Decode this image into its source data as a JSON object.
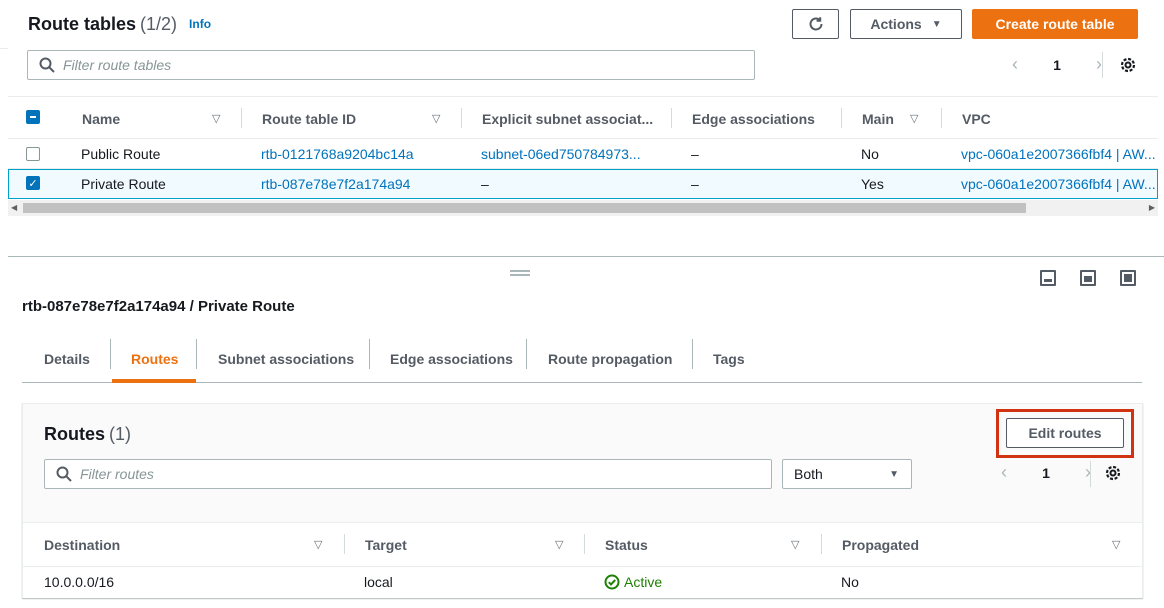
{
  "header": {
    "title": "Route tables",
    "count": "(1/2)",
    "info": "Info",
    "actions_label": "Actions",
    "create_label": "Create route table",
    "search_placeholder": "Filter route tables",
    "page": "1"
  },
  "route_tables": {
    "columns": [
      "Name",
      "Route table ID",
      "Explicit subnet associat...",
      "Edge associations",
      "Main",
      "VPC"
    ],
    "rows": [
      {
        "name": "Public Route",
        "id": "rtb-0121768a9204bc14a",
        "subnet": "subnet-06ed750784973...",
        "edge": "–",
        "main": "No",
        "vpc": "vpc-060a1e2007366fbf4 | AW..."
      },
      {
        "name": "Private Route",
        "id": "rtb-087e78e7f2a174a94",
        "subnet": "–",
        "edge": "–",
        "main": "Yes",
        "vpc": "vpc-060a1e2007366fbf4 | AW..."
      }
    ]
  },
  "detail": {
    "title": "rtb-087e78e7f2a174a94 / Private Route",
    "tabs": [
      "Details",
      "Routes",
      "Subnet associations",
      "Edge associations",
      "Route propagation",
      "Tags"
    ],
    "active_tab": "Routes"
  },
  "routes": {
    "title": "Routes",
    "count": "(1)",
    "edit_label": "Edit routes",
    "search_placeholder": "Filter routes",
    "filter_value": "Both",
    "page": "1",
    "columns": [
      "Destination",
      "Target",
      "Status",
      "Propagated"
    ],
    "rows": [
      {
        "destination": "10.0.0.0/16",
        "target": "local",
        "status": "Active",
        "propagated": "No"
      }
    ]
  },
  "colors": {
    "primary_orange": "#ec7211",
    "link_blue": "#0073bb",
    "status_green": "#1d8102",
    "highlight_red": "#d13212"
  },
  "icons": [
    "refresh-icon",
    "caret-down-icon",
    "search-icon",
    "chevron-left-icon",
    "chevron-right-icon",
    "gear-icon",
    "drag-handle-icon",
    "split-bottom-icon",
    "split-side-icon",
    "full-view-icon",
    "check-circle-icon"
  ]
}
